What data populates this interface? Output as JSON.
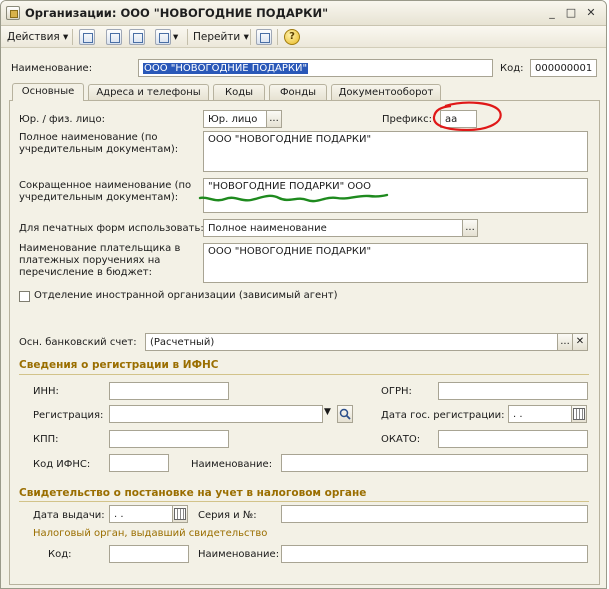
{
  "window": {
    "title": "Организации: ООО \"НОВОГОДНИЕ ПОДАРКИ\"",
    "minimize": "_",
    "maximize": "□",
    "close": "✕"
  },
  "toolbar": {
    "actions": "Действия ▾",
    "goto": "Перейти ▾",
    "help": "?"
  },
  "header": {
    "name_label": "Наименование:",
    "name_value": "ООО \"НОВОГОДНИЕ ПОДАРКИ\"",
    "code_label": "Код:",
    "code_value": "000000001"
  },
  "tabs": [
    "Основные",
    "Адреса и телефоны",
    "Коды",
    "Фонды",
    "Документооборот"
  ],
  "main": {
    "legal_type_label": "Юр. / физ. лицо:",
    "legal_type_value": "Юр. лицо",
    "prefix_label": "Префикс:",
    "prefix_value": "аа",
    "full_name_label": "Полное наименование (по учредительным документам):",
    "full_name_value": "ООО \"НОВОГОДНИЕ ПОДАРКИ\"",
    "short_name_label": "Сокращенное наименование (по учредительным документам):",
    "short_name_value": "\"НОВОГОДНИЕ ПОДАРКИ\" ООО",
    "print_forms_label": "Для печатных форм использовать:",
    "print_forms_value": "Полное наименование",
    "payer_name_label": "Наименование плательщика в платежных поручениях на перечисление в бюджет:",
    "payer_name_value": "ООО \"НОВОГОДНИЕ ПОДАРКИ\"",
    "foreign_branch_label": "Отделение иностранной организации (зависимый агент)",
    "bank_account_label": "Осн. банковский счет:",
    "bank_account_value": "(Расчетный)",
    "ellipsis": "...",
    "clear": "✕"
  },
  "ifns": {
    "title": "Сведения о регистрации в ИФНС",
    "inn_label": "ИНН:",
    "ogrn_label": "ОГРН:",
    "registration_label": "Регистрация:",
    "reg_date_label": "Дата гос. регистрации:",
    "date_placeholder": " .  .",
    "kpp_label": "КПП:",
    "okato_label": "ОКАТО:",
    "ifns_code_label": "Код ИФНС:",
    "ifns_name_label": "Наименование:"
  },
  "certificate": {
    "title": "Свидетельство о постановке на учет в налоговом органе",
    "issue_date_label": "Дата выдачи:",
    "issue_date_value": " .  .",
    "series_label": "Серия и №:",
    "tax_authority_caption": "Налоговый орган, выдавший свидетельство",
    "code_label": "Код:",
    "name_label": "Наименование:"
  },
  "colors": {
    "window_bg": "#f3f1e6",
    "selection": "#2a58b8",
    "section_title": "#9a6e00",
    "red_annotation": "#e01818",
    "green_annotation": "#1e8a1e"
  }
}
